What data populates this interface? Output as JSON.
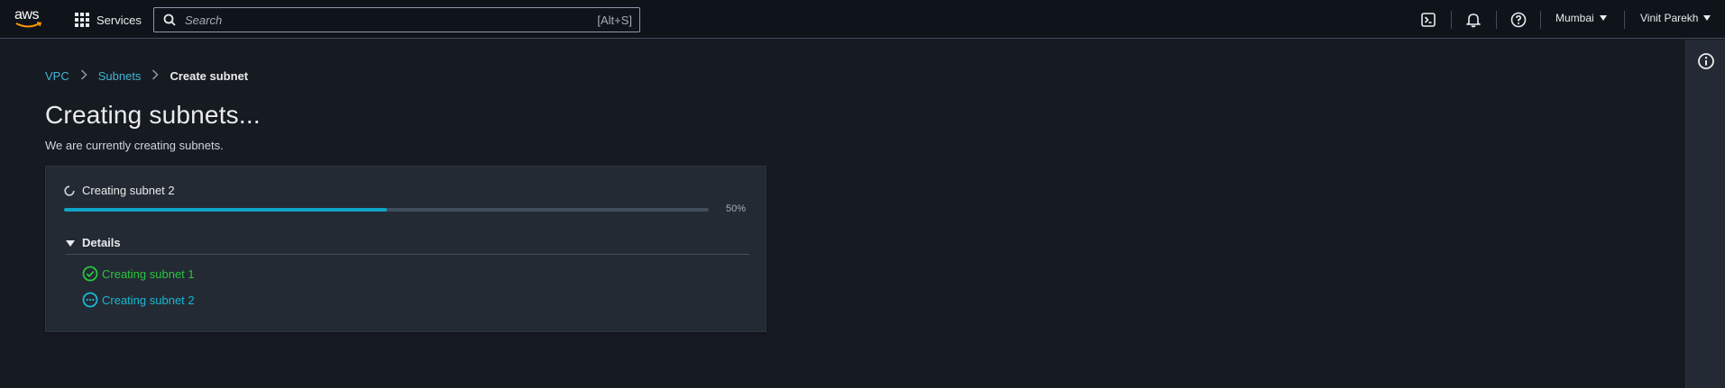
{
  "topnav": {
    "logo_text": "aws",
    "services_label": "Services",
    "search_placeholder": "Search",
    "search_shortcut": "[Alt+S]",
    "region_label": "Mumbai",
    "user_label": "Vinit Parekh",
    "icons": [
      "cloudshell-icon",
      "notifications-icon",
      "help-icon"
    ]
  },
  "breadcrumb": {
    "items": [
      {
        "label": "VPC"
      },
      {
        "label": "Subnets"
      },
      {
        "label": "Create subnet"
      }
    ]
  },
  "page": {
    "title": "Creating subnets...",
    "description": "We are currently creating subnets."
  },
  "progress": {
    "status_text": "Creating subnet 2",
    "percent_label": "50%",
    "percent_value": 50
  },
  "details": {
    "label": "Details",
    "items": [
      {
        "label": "Creating subnet 1",
        "status": "success"
      },
      {
        "label": "Creating subnet 2",
        "status": "in-progress"
      }
    ]
  },
  "colors": {
    "accent": "#0ea5c8",
    "success": "#29c53f",
    "in_progress": "#1ab7d3",
    "link": "#42b4d5"
  }
}
